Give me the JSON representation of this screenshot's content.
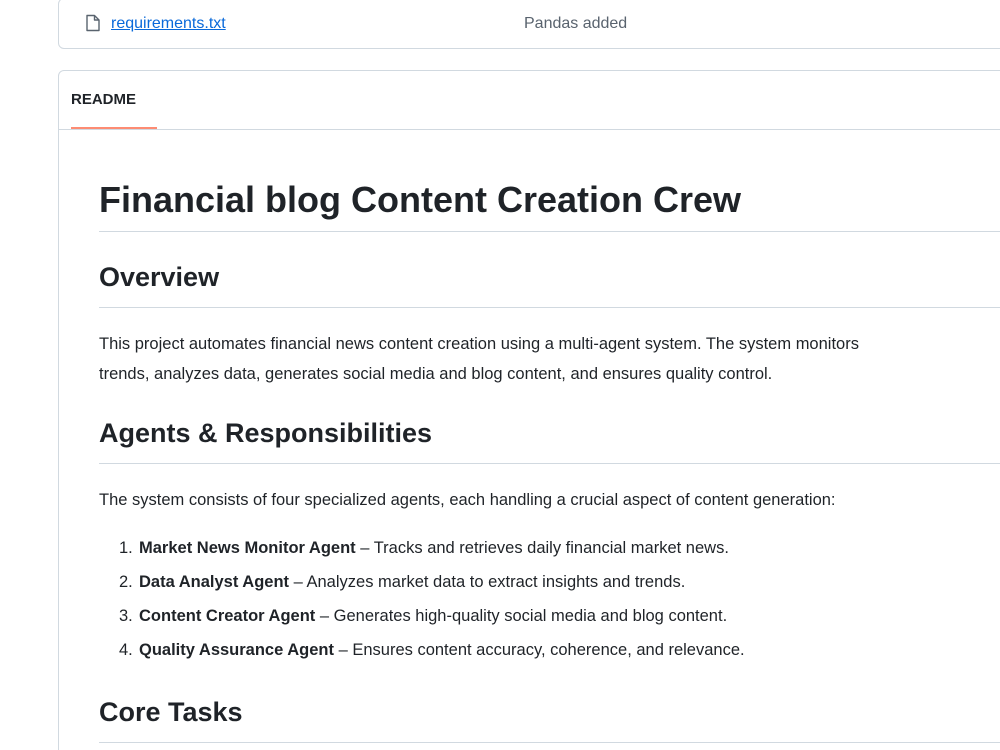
{
  "file_row": {
    "file_name": "requirements.txt",
    "commit_message": "Pandas added",
    "icon": "file-icon"
  },
  "readme": {
    "tab_label": "README",
    "title": "Financial blog Content Creation Crew",
    "overview": {
      "heading": "Overview",
      "line1": "This project automates financial news content creation using a multi-agent system. The system monitors",
      "line2": "trends, analyzes data, generates social media and blog content, and ensures quality control."
    },
    "agents": {
      "heading": "Agents & Responsibilities",
      "intro": "The system consists of four specialized agents, each handling a crucial aspect of content generation:",
      "items": [
        {
          "num": "1.",
          "name": "Market News Monitor Agent",
          "desc": " – Tracks and retrieves daily financial market news."
        },
        {
          "num": "2.",
          "name": "Data Analyst Agent",
          "desc": " – Analyzes market data to extract insights and trends."
        },
        {
          "num": "3.",
          "name": "Content Creator Agent",
          "desc": " – Generates high-quality social media and blog content."
        },
        {
          "num": "4.",
          "name": "Quality Assurance Agent",
          "desc": " – Ensures content accuracy, coherence, and relevance."
        }
      ]
    },
    "core_tasks": {
      "heading": "Core Tasks"
    }
  }
}
